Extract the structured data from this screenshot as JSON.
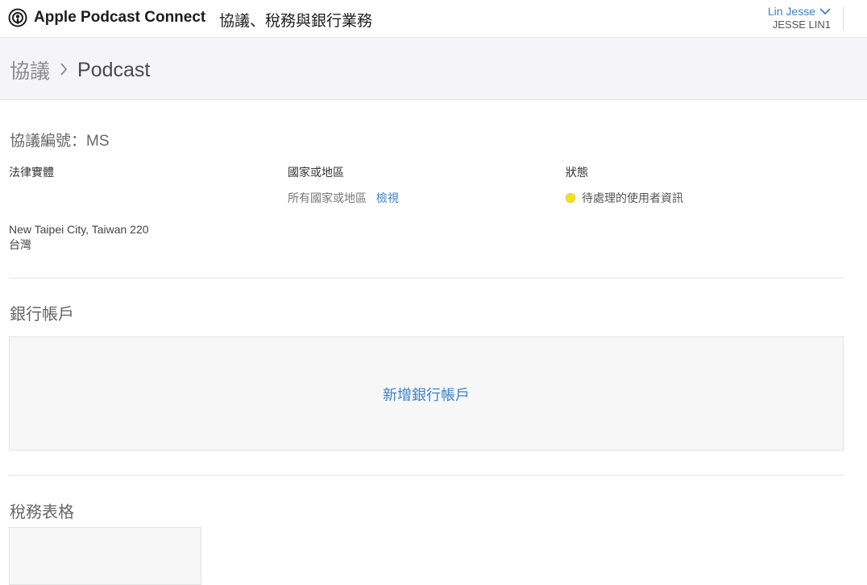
{
  "header": {
    "app_name": "Apple Podcast Connect",
    "section_title": "協議、稅務與銀行業務",
    "user": {
      "name": "Lin Jesse",
      "account": "JESSE LIN1"
    }
  },
  "breadcrumb": {
    "parent": "協議",
    "current": "Podcast"
  },
  "agreement": {
    "number_label": "協議編號：MS",
    "legal_entity_label": "法律實體",
    "legal_entity_address_line": "New Taipei City, Taiwan 220",
    "legal_entity_country": "台灣",
    "regions_label": "國家或地區",
    "regions_value": "所有國家或地區",
    "regions_view_link": "檢視",
    "status_label": "狀態",
    "status_value": "待處理的使用者資訊"
  },
  "bank": {
    "title": "銀行帳戶",
    "add_link": "新增銀行帳戶"
  },
  "tax": {
    "title": "稅務表格"
  },
  "colors": {
    "link": "#3b82c9",
    "status_pending": "#f5e020",
    "subheader_bg": "#f5f5f7"
  },
  "icons": {
    "logo": "podcast-icon",
    "user_menu": "chevron-down-icon",
    "breadcrumb_separator": "chevron-right-icon",
    "status": "status-dot-icon"
  }
}
